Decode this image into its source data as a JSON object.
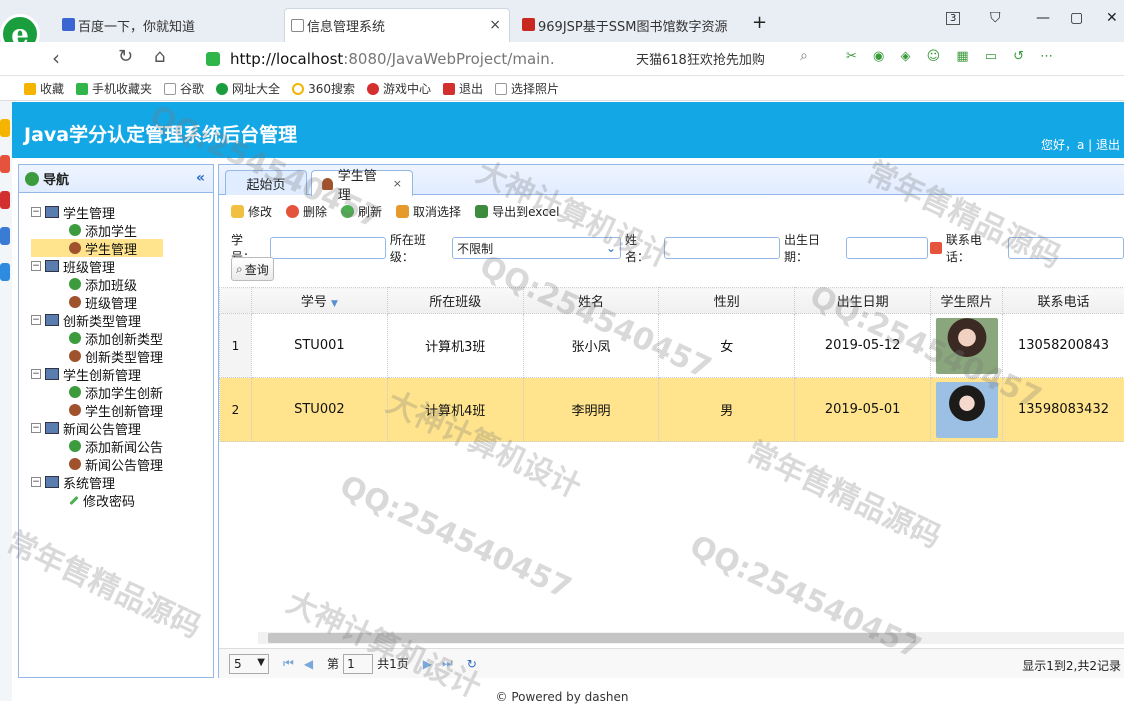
{
  "browser": {
    "tabs": [
      {
        "title": "百度一下，你就知道"
      },
      {
        "title": "信息管理系统"
      },
      {
        "title": "969JSP基于SSM图书馆数字资源"
      }
    ],
    "close_label": "×",
    "new_tab_label": "+",
    "tab_count": "3",
    "address": {
      "host": "http://localhost",
      "rest": ":8080/JavaWebProject/main."
    },
    "promo": "天猫618狂欢抢先加购",
    "bookmarks": [
      "收藏",
      "手机收藏夹",
      "谷歌",
      "网址大全",
      "360搜索",
      "游戏中心",
      "退出",
      "选择照片"
    ]
  },
  "app": {
    "title": "Java学分认定管理系统后台管理",
    "greeting": "您好，a | ",
    "logout": "退出"
  },
  "nav": {
    "title": "导航",
    "collapse_label": "«",
    "groups": [
      {
        "label": "学生管理",
        "children": [
          "添加学生",
          "学生管理"
        ]
      },
      {
        "label": "班级管理",
        "children": [
          "添加班级",
          "班级管理"
        ]
      },
      {
        "label": "创新类型管理",
        "children": [
          "添加创新类型",
          "创新类型管理"
        ]
      },
      {
        "label": "学生创新管理",
        "children": [
          "添加学生创新",
          "学生创新管理"
        ]
      },
      {
        "label": "新闻公告管理",
        "children": [
          "添加新闻公告",
          "新闻公告管理"
        ]
      },
      {
        "label": "系统管理",
        "children": [
          "修改密码"
        ]
      }
    ]
  },
  "main": {
    "tabs": [
      {
        "label": "起始页"
      },
      {
        "label": "学生管理"
      }
    ],
    "toolbar": [
      "修改",
      "删除",
      "刷新",
      "取消选择",
      "导出到excel"
    ],
    "search": {
      "student_no_label": "学号：",
      "class_label": "所在班级：",
      "class_value": "不限制",
      "name_label": "姓名：",
      "birth_label": "出生日期：",
      "phone_label": "联系电话："
    },
    "query_label": "查询",
    "columns": [
      "学号",
      "所在班级",
      "姓名",
      "性别",
      "出生日期",
      "学生照片",
      "联系电话"
    ],
    "rows": [
      {
        "rn": "1",
        "student_no": "STU001",
        "class": "计算机3班",
        "name": "张小凤",
        "gender": "女",
        "birth": "2019-05-12",
        "phone": "13058200843"
      },
      {
        "rn": "2",
        "student_no": "STU002",
        "class": "计算机4班",
        "name": "李明明",
        "gender": "男",
        "birth": "2019-05-01",
        "phone": "13598083432"
      }
    ],
    "pager": {
      "page_size": "5",
      "page_prefix": "第",
      "page_value": "1",
      "page_suffix": "共1页",
      "info": "显示1到2,共2记录"
    }
  },
  "footer": "© Powered by dashen",
  "watermarks": [
    "QQ:254540457",
    "大神计算机设计",
    "常年售精品源码"
  ]
}
